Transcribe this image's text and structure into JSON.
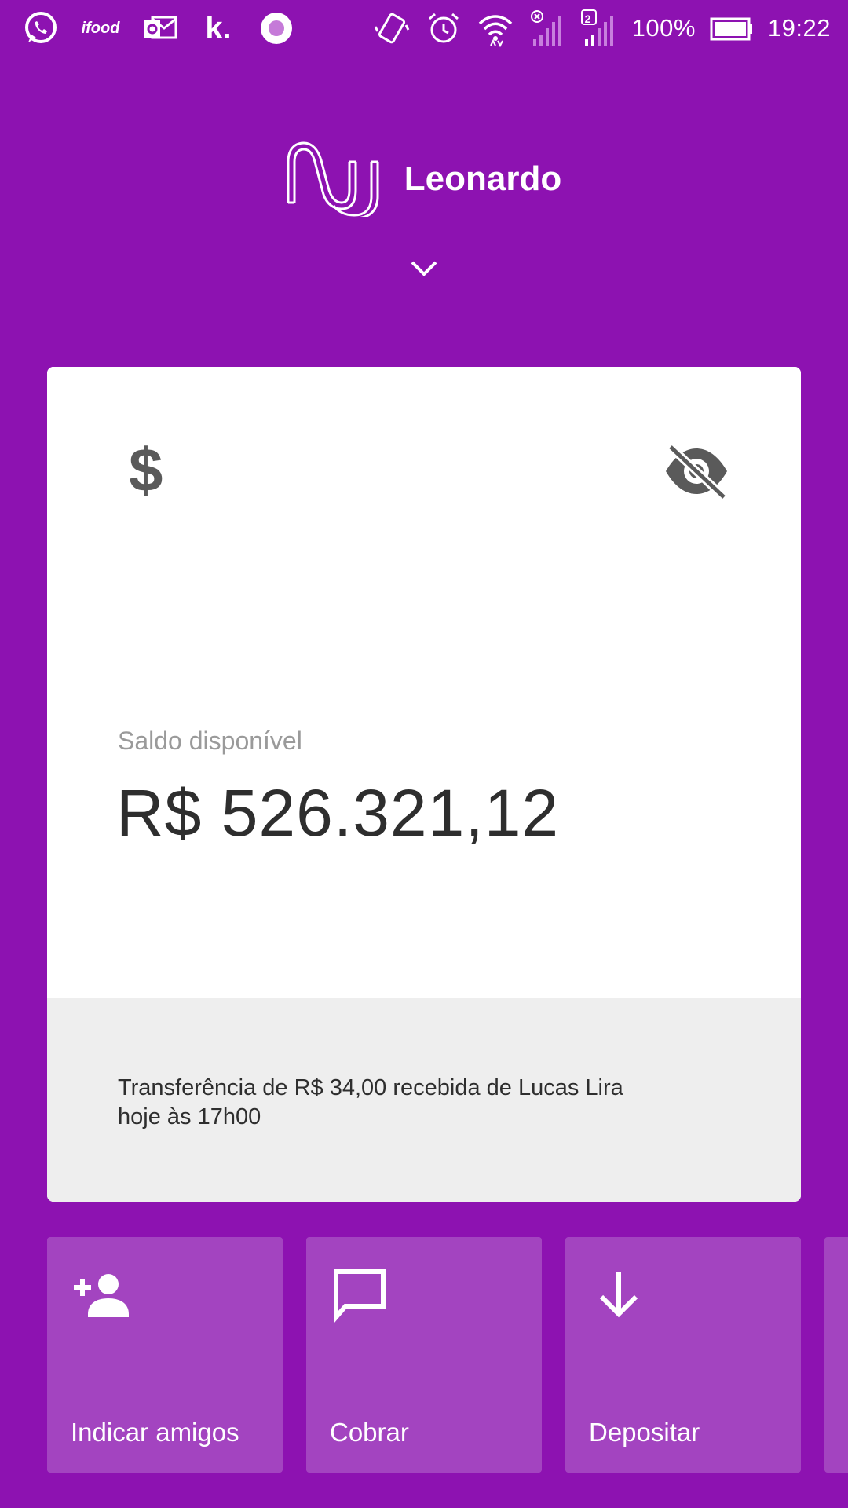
{
  "status_bar": {
    "notification_icons": [
      "whatsapp-icon",
      "ifood-icon",
      "outlook-icon",
      "kwai-icon",
      "circle-app-icon"
    ],
    "system_icons": [
      "vibrate-icon",
      "alarm-icon",
      "wifi-icon",
      "signal-sim1-icon",
      "signal-sim2-icon"
    ],
    "ifood_label": "ifood",
    "kwai_label": "k.",
    "sim2_badge": "2",
    "battery_percent": "100%",
    "time": "19:22"
  },
  "header": {
    "user_name": "Leonardo"
  },
  "card": {
    "balance_label": "Saldo disponível",
    "balance_value": "R$ 526.321,12",
    "dollar_symbol": "$",
    "notice": "Transferência de R$ 34,00 recebida de Lucas Lira hoje às 17h00"
  },
  "actions": [
    {
      "label": "Indicar amigos",
      "icon": "add-person-icon"
    },
    {
      "label": "Cobrar",
      "icon": "chat-bubble-icon"
    },
    {
      "label": "Depositar",
      "icon": "arrow-down-icon"
    }
  ],
  "colors": {
    "background": "#8d12b1",
    "tile": "#a344c0",
    "card": "#ffffff",
    "card_footer": "#eeeeee"
  }
}
